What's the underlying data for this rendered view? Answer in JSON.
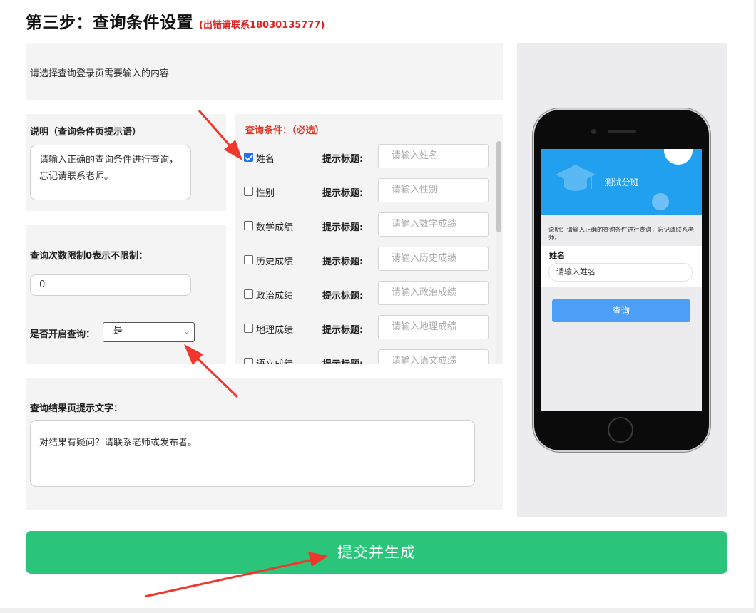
{
  "header": {
    "title": "第三步：查询条件设置",
    "error_contact": "(出错请联系18030135777)"
  },
  "intro": {
    "text": "请选择查询登录页需要输入的内容"
  },
  "description": {
    "label": "说明（查询条件页提示语）",
    "value": "请输入正确的查询条件进行查询，忘记请联系老师。"
  },
  "limits": {
    "query_limit_label": "查询次数限制0表示不限制：",
    "query_limit_value": "0",
    "enable_label": "是否开启查询：",
    "enable_selected": "是"
  },
  "conditions": {
    "title": "查询条件：（必选）",
    "hint_label": "提示标题:",
    "items": [
      {
        "name": "姓名",
        "checked": true,
        "placeholder": "请输入姓名"
      },
      {
        "name": "性别",
        "checked": false,
        "placeholder": "请输入性别"
      },
      {
        "name": "数学成绩",
        "checked": false,
        "placeholder": "请输入数学成绩"
      },
      {
        "name": "历史成绩",
        "checked": false,
        "placeholder": "请输入历史成绩"
      },
      {
        "name": "政治成绩",
        "checked": false,
        "placeholder": "请输入政治成绩"
      },
      {
        "name": "地理成绩",
        "checked": false,
        "placeholder": "请输入地理成绩"
      },
      {
        "name": "语文成绩",
        "checked": false,
        "placeholder": "请输入语文成绩"
      }
    ]
  },
  "result": {
    "label": "查询结果页提示文字：",
    "value": "对结果有疑问？请联系老师或发布者。"
  },
  "preview": {
    "title": "测试分班",
    "description": "说明：请输入正确的查询条件进行查询，忘记请联系老师。",
    "field_label": "姓名",
    "field_placeholder": "请输入姓名",
    "button_label": "查询"
  },
  "submit": {
    "label": "提交并生成"
  },
  "colors": {
    "error_red": "#e02020",
    "condition_title_red": "#e03b2a",
    "submit_green": "#2ac47b",
    "preview_header_blue": "#22a0f0",
    "preview_button_blue": "#4d9ef6",
    "checkbox_blue": "#1a73e8",
    "annotation_arrow_red": "#f0372e"
  }
}
